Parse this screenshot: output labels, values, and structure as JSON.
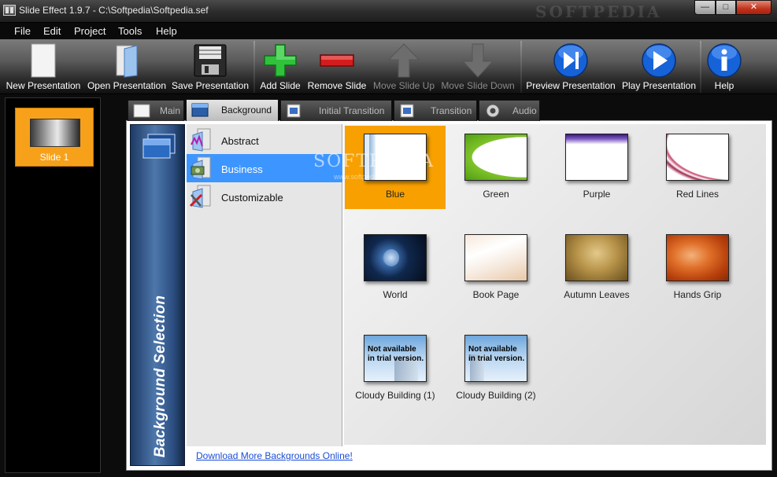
{
  "window": {
    "title": "Slide Effect 1.9.7 - C:\\Softpedia\\Softpedia.sef",
    "watermark": "SOFTPEDIA",
    "min_glyph": "—",
    "max_glyph": "□",
    "close_glyph": "✕"
  },
  "menu": [
    "File",
    "Edit",
    "Project",
    "Tools",
    "Help"
  ],
  "toolbar": {
    "new_presentation": "New Presentation",
    "open_presentation": "Open Presentation",
    "save_presentation": "Save Presentation",
    "add_slide": "Add Slide",
    "remove_slide": "Remove Slide",
    "move_slide_up": "Move Slide Up",
    "move_slide_down": "Move Slide Down",
    "preview_presentation": "Preview Presentation",
    "play_presentation": "Play Presentation",
    "help": "Help"
  },
  "slides": [
    {
      "label": "Slide 1",
      "selected": true
    }
  ],
  "tabs": [
    {
      "label": "Main",
      "active": false
    },
    {
      "label": "Background",
      "active": true
    },
    {
      "label": "Initial Transition",
      "active": false
    },
    {
      "label": "Transition",
      "active": false
    },
    {
      "label": "Audio",
      "active": false
    }
  ],
  "panel": {
    "banner_title": "Background Selection",
    "download_link": "Download More Backgrounds Online!",
    "watermark": "SOFTPEDIA",
    "watermark_sub": "www.softpedia.com"
  },
  "categories": [
    {
      "label": "Abstract",
      "selected": false
    },
    {
      "label": "Business",
      "selected": true
    },
    {
      "label": "Customizable",
      "selected": false
    }
  ],
  "backgrounds": [
    {
      "label": "Blue",
      "selected": true
    },
    {
      "label": "Green",
      "selected": false
    },
    {
      "label": "Purple",
      "selected": false
    },
    {
      "label": "Red Lines",
      "selected": false
    },
    {
      "label": "World",
      "selected": false
    },
    {
      "label": "Book Page",
      "selected": false
    },
    {
      "label": "Autumn Leaves",
      "selected": false
    },
    {
      "label": "Hands Grip",
      "selected": false
    },
    {
      "label": "Cloudy Building (1)",
      "selected": false,
      "trial_text_line1": "Not available",
      "trial_text_line2": "in trial version."
    },
    {
      "label": "Cloudy Building (2)",
      "selected": false,
      "trial_text_line1": "Not available",
      "trial_text_line2": "in trial version."
    }
  ],
  "colors": {
    "selection_orange": "#f7a000",
    "selection_blue": "#3d96ff",
    "link_blue": "#1a4dd4",
    "banner_blue": "#2b4d80"
  }
}
